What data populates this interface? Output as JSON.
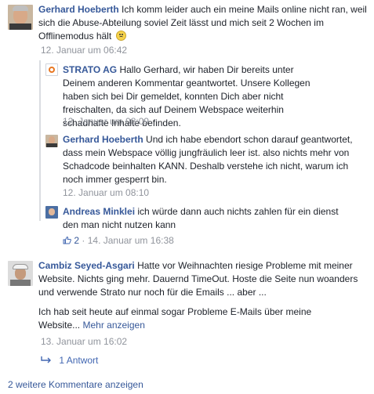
{
  "comments": [
    {
      "author": "Gerhard Hoeberth",
      "text": "Ich komm leider auch ein meine Mails online nicht ran, weil sich die Abuse-Abteilung soviel Zeit lässt und mich seit 2 Wochen im Offlinemodus hält",
      "time": "12. Januar um 06:42"
    },
    {
      "author": "STRATO AG",
      "text": "Hallo Gerhard, wir haben Dir bereits unter Deinem anderen Kommentar geantwortet. Unsere Kollegen haben sich bei Dir gemeldet, konnten Dich aber nicht freischalten, da sich auf Deinem Webspace weiterhin schadhafte Inhalte befinden.",
      "time": "12. Januar um 08:09"
    },
    {
      "author": "Gerhard Hoeberth",
      "text": "Und ich habe ebendort schon darauf geantwortet, dass mein Webspace völlig jungfräulich leer ist. also nichts mehr von Schadcode beinhalten KANN. Deshalb verstehe ich nicht, warum ich noch immer gesperrt bin.",
      "time": "12. Januar um 08:10"
    },
    {
      "author": "Andreas Minklei",
      "text": "ich würde dann auch nichts zahlen für ein dienst den man nicht nutzen kann",
      "likes": "2",
      "time": "14. Januar um 16:38"
    },
    {
      "author": "Cambiz Seyed-Asgari",
      "text": "Hatte vor Weihnachten riesige Probleme mit meiner Website. Nichts ging mehr. Dauernd TimeOut. Hoste die Seite nun woanders und verwende Strato nur noch für die Emails ... aber ...",
      "text2": "Ich hab seit heute auf einmal sogar Probleme E-Mails über meine Website...",
      "more": "Mehr anzeigen",
      "time": "13. Januar um 16:02",
      "replies": "1 Antwort"
    }
  ],
  "footer": {
    "more_comments": "2 weitere Kommentare anzeigen"
  },
  "colors": {
    "link": "#365899",
    "meta": "#90949c",
    "text": "#1d2129"
  }
}
